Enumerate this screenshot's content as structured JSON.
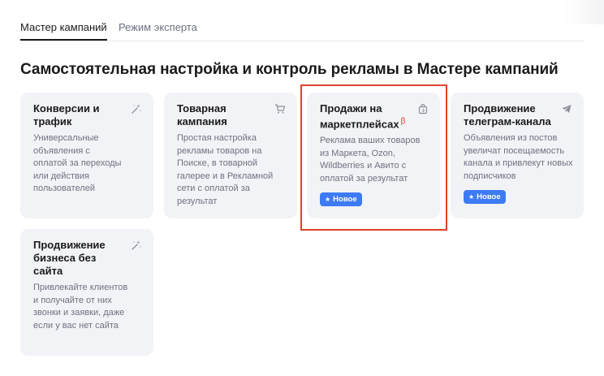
{
  "tabs": [
    {
      "label": "Мастер кампаний",
      "active": true
    },
    {
      "label": "Режим эксперта",
      "active": false
    }
  ],
  "heading": "Самостоятельная настройка и контроль рекламы в Мастере кампаний",
  "cards": [
    {
      "title": "Конверсии и трафик",
      "icon": "magic-wand-icon",
      "description": "Универсальные объявления с оплатой за переходы или действия пользователей"
    },
    {
      "title": "Товарная кампания",
      "icon": "shopping-cart-icon",
      "description": "Простая настройка рекламы товаров на Поиске, в товарной галерее и в Рекламной сети с оплатой за результат"
    },
    {
      "title": "Продажи на маркетплейсах",
      "beta": "β",
      "icon": "shopping-bag-icon",
      "description": "Реклама ваших товаров из Маркета, Ozon, Wildberries и Авито с оплатой за результат",
      "badge": "Новое"
    },
    {
      "title": "Продвижение телеграм-канала",
      "icon": "telegram-plane-icon",
      "description": "Объявления из постов увеличат посещаемость канала и привлекут новых подписчиков",
      "badge": "Новое"
    },
    {
      "title": "Продвижение бизнеса без сайта",
      "icon": "magic-wand-icon",
      "description": "Привлекайте клиентов и получайте от них звонки и заявки, даже если у вас нет сайта"
    }
  ],
  "colors": {
    "card_bg": "#f2f3f6",
    "badge_bg": "#3d7bf5",
    "highlight_border": "#e0412c",
    "beta_color": "#e23c2b"
  }
}
